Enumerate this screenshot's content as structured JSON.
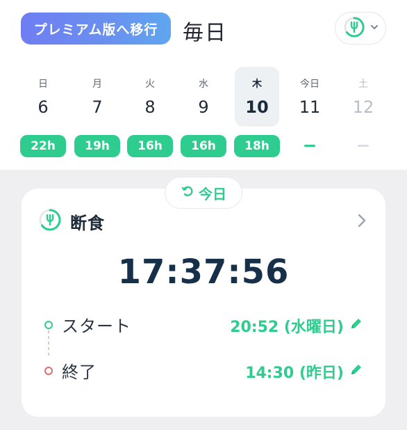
{
  "header": {
    "premium_label": "プレミアム版へ移行",
    "frequency_title": "毎日",
    "plan_icon": "fork-ring-icon",
    "dropdown_icon": "chevron-down-icon"
  },
  "week": {
    "days": [
      {
        "dow": "日",
        "num": "6",
        "hours": "22h"
      },
      {
        "dow": "月",
        "num": "7",
        "hours": "19h"
      },
      {
        "dow": "火",
        "num": "8",
        "hours": "16h"
      },
      {
        "dow": "水",
        "num": "9",
        "hours": "16h"
      },
      {
        "dow": "木",
        "num": "10",
        "hours": "18h"
      },
      {
        "dow": "今日",
        "num": "11",
        "hours": ""
      },
      {
        "dow": "土",
        "num": "12",
        "hours": ""
      }
    ],
    "selected_index": 4
  },
  "today_chip": {
    "label": "今日"
  },
  "card": {
    "title": "断食",
    "timer": "17:37:56",
    "start_label": "スタート",
    "start_time": "20:52 (水曜日)",
    "end_label": "終了",
    "end_time": "14:30 (昨日)"
  },
  "colors": {
    "accent_green": "#2ecc8f",
    "premium_gradient_start": "#6f7df2",
    "premium_gradient_end": "#5fa6ef",
    "timer_text": "#173049",
    "end_dot": "#e06b6b"
  }
}
